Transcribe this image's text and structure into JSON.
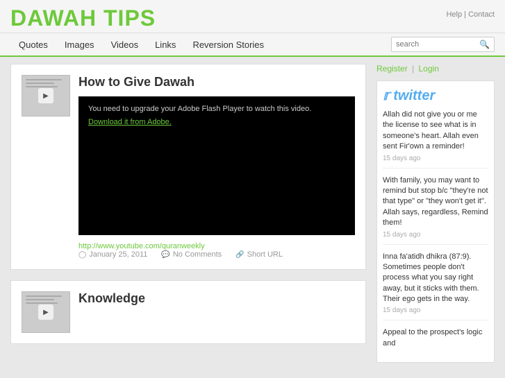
{
  "header": {
    "logo": "DAWAH TIPS",
    "help_label": "Help",
    "contact_label": "Contact"
  },
  "nav": {
    "items": [
      {
        "label": "Quotes",
        "id": "quotes"
      },
      {
        "label": "Images",
        "id": "images"
      },
      {
        "label": "Videos",
        "id": "videos"
      },
      {
        "label": "Links",
        "id": "links"
      },
      {
        "label": "Reversion Stories",
        "id": "reversion-stories"
      }
    ],
    "search_placeholder": "search"
  },
  "sidebar": {
    "register_label": "Register",
    "login_label": "Login",
    "twitter_label": "twitter",
    "tweets": [
      {
        "text": "Allah did not give you or me the license to see what is in someone's heart. Allah even sent Fir'own a reminder!",
        "time": "15 days ago"
      },
      {
        "text": "With family, you may want to remind but stop b/c \"they're not that type\" or \"they won't get it\". Allah says, regardless, Remind them!",
        "time": "15 days ago"
      },
      {
        "text": "Inna fa'atidh dhikra (87:9). Sometimes people don't process what you say right away, but it sticks with them. Their ego gets in the way.",
        "time": "15 days ago"
      },
      {
        "text": "Appeal to the prospect's logic and",
        "time": ""
      }
    ]
  },
  "articles": [
    {
      "title": "How to Give Dawah",
      "video_message": "You need to upgrade your Adobe Flash Player to watch this video.",
      "video_link_text": "Download it from Adobe.",
      "article_url": "http://www.youtube.com/quranweekly",
      "date": "January 25, 2011",
      "comments": "No Comments",
      "short_url_label": "Short URL"
    },
    {
      "title": "Knowledge"
    }
  ]
}
